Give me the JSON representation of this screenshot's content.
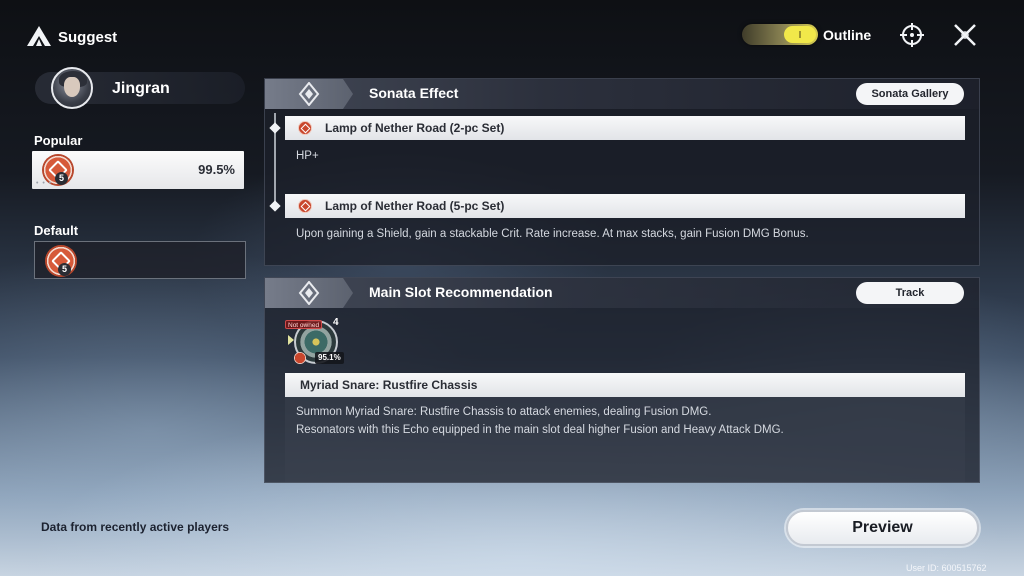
{
  "header": {
    "title": "Suggest",
    "outline_label": "Outline",
    "outline_toggle_on": true,
    "accent_color": "#f1e84a"
  },
  "character": {
    "name": "Jingran"
  },
  "left_panel": {
    "popular_label": "Popular",
    "popular": {
      "sonata_count": "5",
      "percent": "99.5%"
    },
    "default_label": "Default",
    "default": {
      "sonata_count": "5"
    }
  },
  "sonata_effect": {
    "title": "Sonata Effect",
    "gallery_button": "Sonata Gallery",
    "sets": [
      {
        "name": "Lamp of Nether Road (2-pc Set)",
        "description": "HP+"
      },
      {
        "name": "Lamp of Nether Road (5-pc Set)",
        "description": "Upon gaining a Shield, gain a stackable Crit. Rate increase. At max stacks, gain Fusion DMG Bonus."
      }
    ]
  },
  "main_slot": {
    "title": "Main Slot Recommendation",
    "track_button": "Track",
    "echo": {
      "status": "Not owned",
      "cost": "4",
      "percent": "95.1%",
      "name": "Myriad Snare: Rustfire Chassis",
      "description_line1": "Summon Myriad Snare: Rustfire Chassis to attack enemies, dealing Fusion DMG.",
      "description_line2": "Resonators with this Echo equipped in the main slot deal higher Fusion and Heavy Attack DMG."
    }
  },
  "footer": {
    "note": "Data from recently active players",
    "preview_button": "Preview",
    "user_id": "User ID: 600515762"
  },
  "icons": [
    "logo-icon",
    "crosshair-icon",
    "close-icon",
    "sonata-emblem-icon",
    "lamp-of-nether-road-icon",
    "echo-icon"
  ]
}
